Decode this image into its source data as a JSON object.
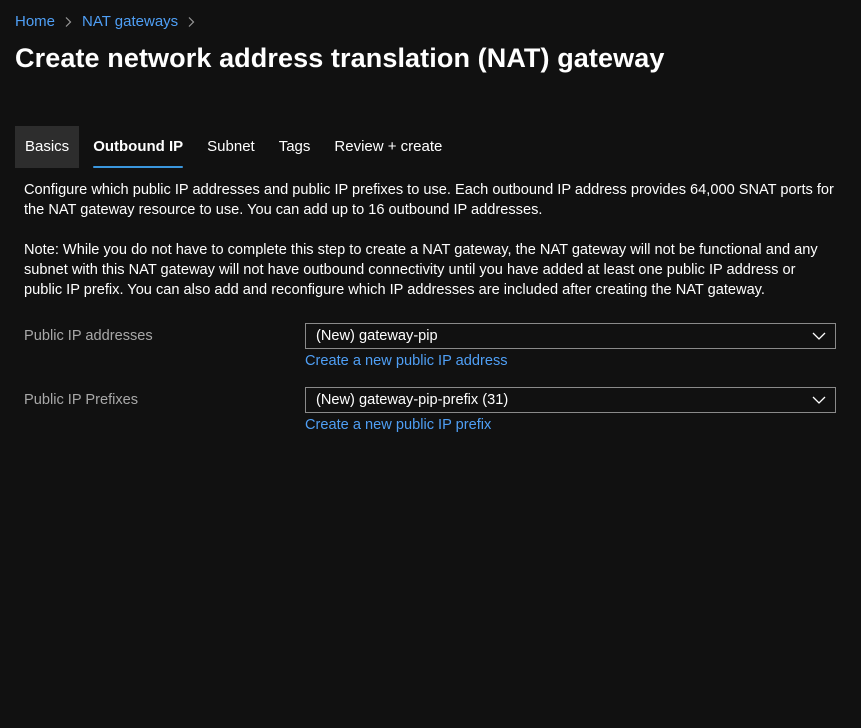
{
  "breadcrumb": {
    "items": [
      {
        "label": "Home"
      },
      {
        "label": "NAT gateways"
      }
    ]
  },
  "page_title": "Create network address translation (NAT) gateway",
  "tabs": [
    {
      "label": "Basics",
      "state": "hover"
    },
    {
      "label": "Outbound IP",
      "state": "active"
    },
    {
      "label": "Subnet",
      "state": "normal"
    },
    {
      "label": "Tags",
      "state": "normal"
    },
    {
      "label": "Review + create",
      "state": "normal"
    }
  ],
  "description": {
    "paragraph1": "Configure which public IP addresses and public IP prefixes to use. Each outbound IP address provides 64,000 SNAT ports for the NAT gateway resource to use. You can add up to 16 outbound IP addresses.",
    "paragraph2": "Note: While you do not have to complete this step to create a NAT gateway, the NAT gateway will not be functional and any subnet with this NAT gateway will not have outbound connectivity until you have added at least one public IP address or public IP prefix. You can also add and reconfigure which IP addresses are included after creating the NAT gateway."
  },
  "form": {
    "public_ip_addresses": {
      "label": "Public IP addresses",
      "value": "(New) gateway-pip",
      "create_link": "Create a new public IP address"
    },
    "public_ip_prefixes": {
      "label": "Public IP Prefixes",
      "value": "(New) gateway-pip-prefix (31)",
      "create_link": "Create a new public IP prefix"
    }
  },
  "colors": {
    "background": "#111111",
    "link": "#4f9ff5",
    "tab_underline": "#3a96dd",
    "label_muted": "#a8a8a8",
    "input_border": "#8a8a8a"
  },
  "icons": {
    "breadcrumb_separator": "chevron-right-icon",
    "dropdown": "chevron-down-icon"
  }
}
